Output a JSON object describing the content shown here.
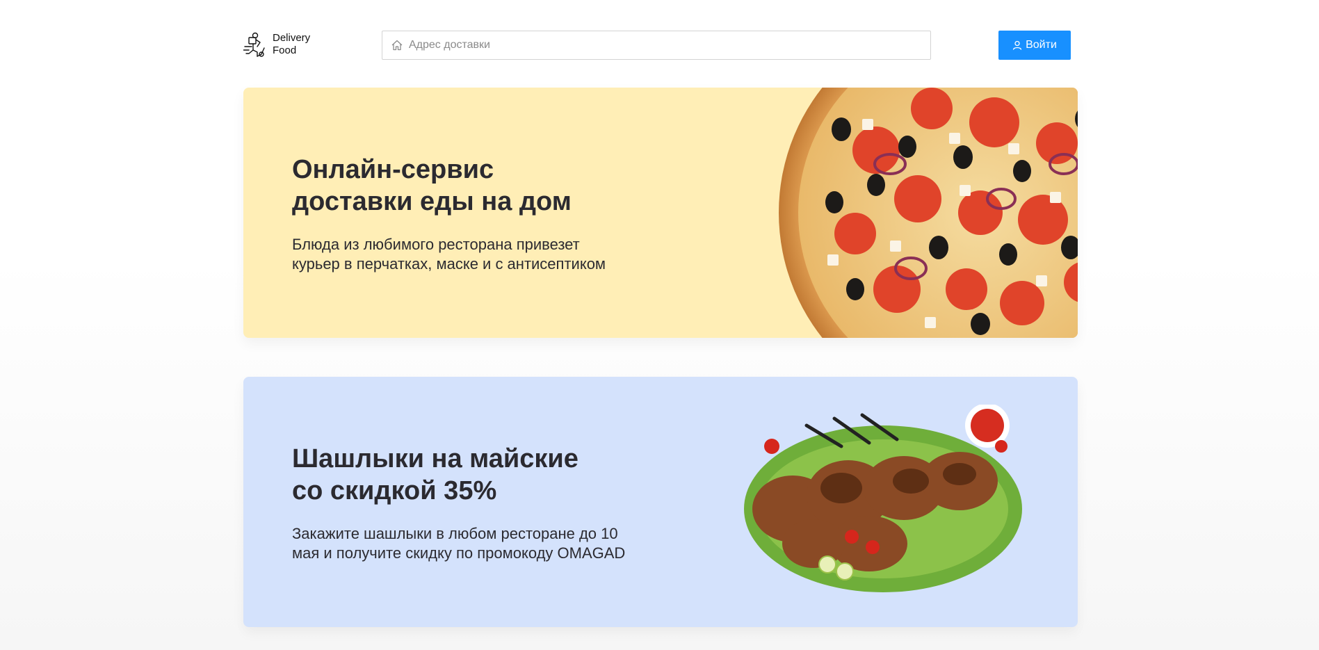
{
  "header": {
    "logo_line1": "Delivery",
    "logo_line2": "Food",
    "search_placeholder": "Адрес доставки",
    "login_label": "Войти"
  },
  "promos": [
    {
      "title": "Онлайн-сервис\nдоставки еды на дом",
      "text": "Блюда из любимого ресторана привезет\nкурьер в перчатках, маске и с антисептиком",
      "background": "#ffeeb6",
      "image": "pizza"
    },
    {
      "title": "Шашлыки на майские\nсо скидкой 35%",
      "text": "Закажите шашлыки в любом ресторане до 10\nмая и получите скидку по промокоду OMAGAD",
      "background": "#d4e2fc",
      "image": "grilled-meat"
    }
  ],
  "colors": {
    "accent": "#1890ff",
    "text": "#2b2a30"
  }
}
